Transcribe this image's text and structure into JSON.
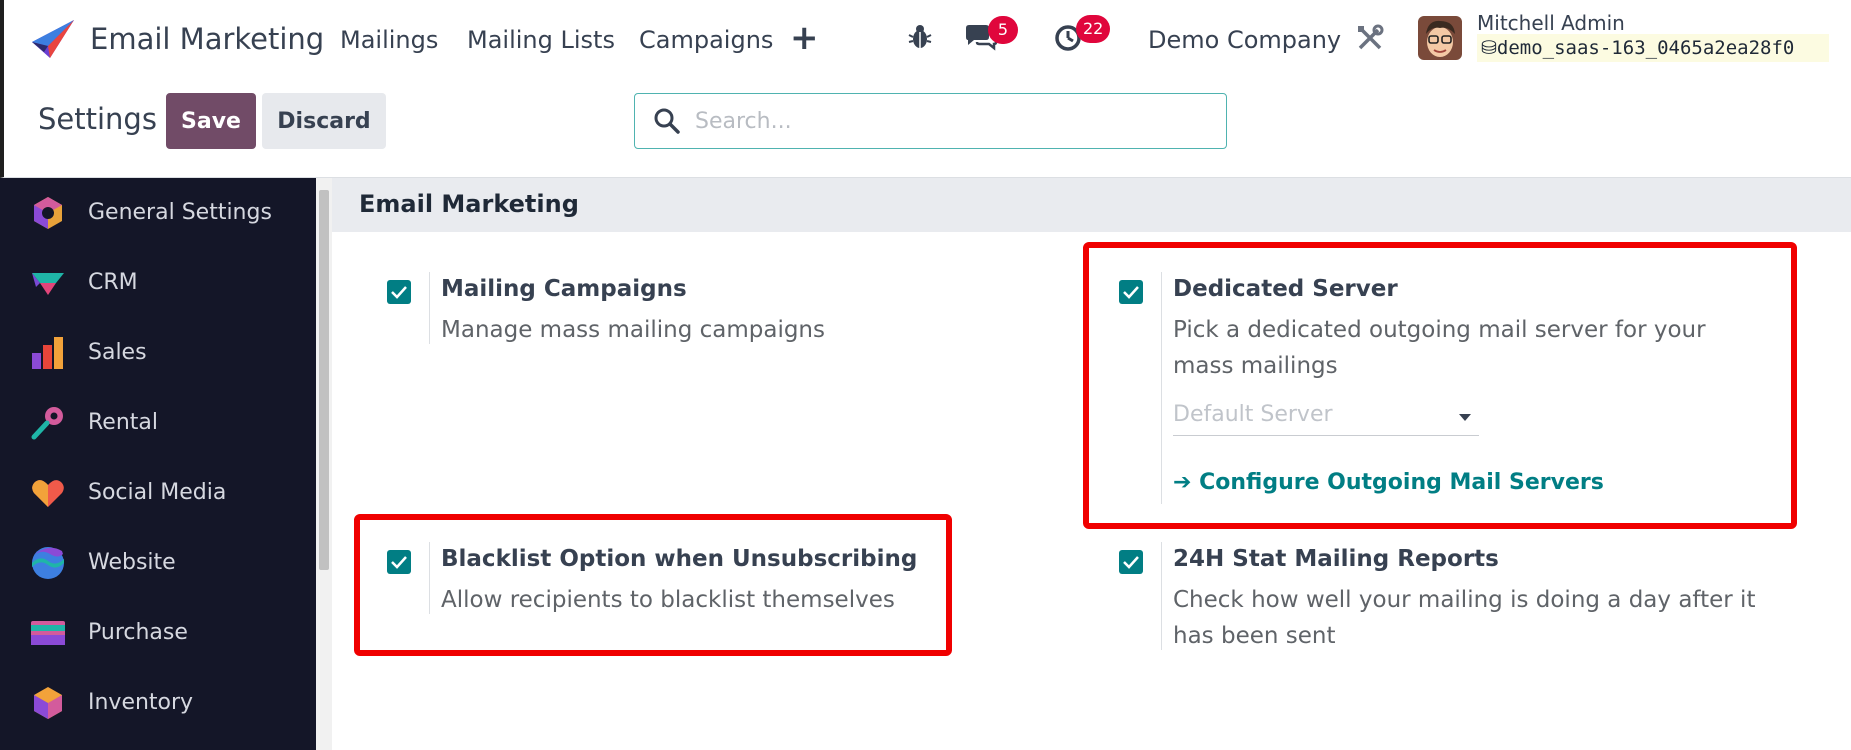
{
  "navbar": {
    "brand": "Email Marketing",
    "menu": [
      "Mailings",
      "Mailing Lists",
      "Campaigns"
    ],
    "messages_count": "5",
    "activities_count": "22",
    "company": "Demo Company",
    "user_name": "Mitchell Admin",
    "database": "demo_saas-163_0465a2ea28f0"
  },
  "control_panel": {
    "title": "Settings",
    "save_label": "Save",
    "discard_label": "Discard",
    "search_placeholder": "Search..."
  },
  "sidebar": {
    "items": [
      {
        "label": "General Settings",
        "icon": "general-settings-icon"
      },
      {
        "label": "CRM",
        "icon": "crm-icon"
      },
      {
        "label": "Sales",
        "icon": "sales-icon"
      },
      {
        "label": "Rental",
        "icon": "rental-icon"
      },
      {
        "label": "Social Media",
        "icon": "social-media-icon"
      },
      {
        "label": "Website",
        "icon": "website-icon"
      },
      {
        "label": "Purchase",
        "icon": "purchase-icon"
      },
      {
        "label": "Inventory",
        "icon": "inventory-icon"
      }
    ]
  },
  "section": {
    "title": "Email Marketing",
    "settings": [
      {
        "title": "Mailing Campaigns",
        "description": "Manage mass mailing campaigns",
        "checked": true
      },
      {
        "title": "Dedicated Server",
        "description": "Pick a dedicated outgoing mail server for your mass mailings",
        "checked": true,
        "select_value": "Default Server",
        "link": "Configure Outgoing Mail Servers"
      },
      {
        "title": "Blacklist Option when Unsubscribing",
        "description": "Allow recipients to blacklist themselves",
        "checked": true
      },
      {
        "title": "24H Stat Mailing Reports",
        "description": "Check how well your mailing is doing a day after it has been sent",
        "checked": true
      }
    ]
  },
  "colors": {
    "primary": "#714b67",
    "checkbox": "#017e84",
    "sidebar_bg": "#141628",
    "highlight": "#f00000",
    "badge": "#e0063c"
  }
}
